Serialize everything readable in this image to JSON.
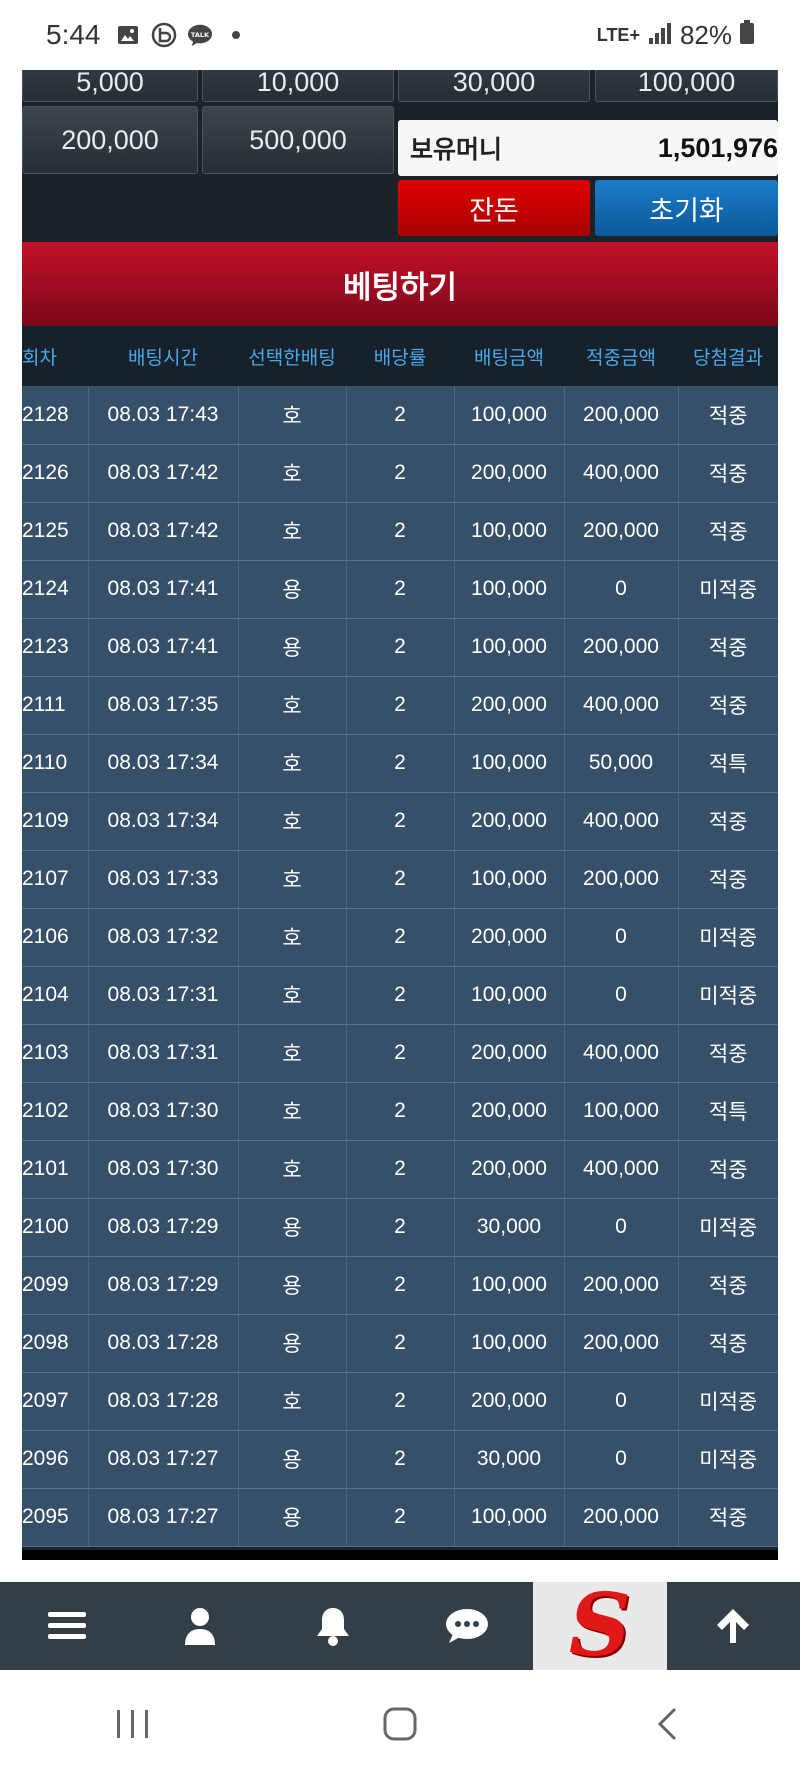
{
  "status": {
    "time": "5:44",
    "network": "LTE+",
    "battery": "82%",
    "icons": [
      "image-icon",
      "b-app-icon",
      "talk-icon",
      "dot-icon"
    ]
  },
  "chips": {
    "row1": [
      "5,000",
      "10,000",
      "30,000",
      "100,000"
    ],
    "row2": [
      "200,000",
      "500,000"
    ]
  },
  "balance": {
    "label": "보유머니",
    "value": "1,501,976"
  },
  "buttons": {
    "all_in": "잔돈",
    "reset": "초기화"
  },
  "bet_title": "베팅하기",
  "table": {
    "headers": [
      "회차",
      "배팅시간",
      "선택한배팅",
      "배당률",
      "배팅금액",
      "적중금액",
      "당첨결과"
    ],
    "rows": [
      {
        "round": "2128",
        "time": "08.03 17:43",
        "pick": "호",
        "odds": "2",
        "bet": "100,000",
        "win": "200,000",
        "result": "적중",
        "type": "win"
      },
      {
        "round": "2126",
        "time": "08.03 17:42",
        "pick": "호",
        "odds": "2",
        "bet": "200,000",
        "win": "400,000",
        "result": "적중",
        "type": "win"
      },
      {
        "round": "2125",
        "time": "08.03 17:42",
        "pick": "호",
        "odds": "2",
        "bet": "100,000",
        "win": "200,000",
        "result": "적중",
        "type": "win"
      },
      {
        "round": "2124",
        "time": "08.03 17:41",
        "pick": "용",
        "odds": "2",
        "bet": "100,000",
        "win": "0",
        "result": "미적중",
        "type": "lose"
      },
      {
        "round": "2123",
        "time": "08.03 17:41",
        "pick": "용",
        "odds": "2",
        "bet": "100,000",
        "win": "200,000",
        "result": "적중",
        "type": "win"
      },
      {
        "round": "2111",
        "time": "08.03 17:35",
        "pick": "호",
        "odds": "2",
        "bet": "200,000",
        "win": "400,000",
        "result": "적중",
        "type": "win"
      },
      {
        "round": "2110",
        "time": "08.03 17:34",
        "pick": "호",
        "odds": "2",
        "bet": "100,000",
        "win": "50,000",
        "result": "적특",
        "type": "special"
      },
      {
        "round": "2109",
        "time": "08.03 17:34",
        "pick": "호",
        "odds": "2",
        "bet": "200,000",
        "win": "400,000",
        "result": "적중",
        "type": "win"
      },
      {
        "round": "2107",
        "time": "08.03 17:33",
        "pick": "호",
        "odds": "2",
        "bet": "100,000",
        "win": "200,000",
        "result": "적중",
        "type": "win"
      },
      {
        "round": "2106",
        "time": "08.03 17:32",
        "pick": "호",
        "odds": "2",
        "bet": "200,000",
        "win": "0",
        "result": "미적중",
        "type": "lose"
      },
      {
        "round": "2104",
        "time": "08.03 17:31",
        "pick": "호",
        "odds": "2",
        "bet": "100,000",
        "win": "0",
        "result": "미적중",
        "type": "lose"
      },
      {
        "round": "2103",
        "time": "08.03 17:31",
        "pick": "호",
        "odds": "2",
        "bet": "200,000",
        "win": "400,000",
        "result": "적중",
        "type": "win"
      },
      {
        "round": "2102",
        "time": "08.03 17:30",
        "pick": "호",
        "odds": "2",
        "bet": "200,000",
        "win": "100,000",
        "result": "적특",
        "type": "special"
      },
      {
        "round": "2101",
        "time": "08.03 17:30",
        "pick": "호",
        "odds": "2",
        "bet": "200,000",
        "win": "400,000",
        "result": "적중",
        "type": "win"
      },
      {
        "round": "2100",
        "time": "08.03 17:29",
        "pick": "용",
        "odds": "2",
        "bet": "30,000",
        "win": "0",
        "result": "미적중",
        "type": "lose"
      },
      {
        "round": "2099",
        "time": "08.03 17:29",
        "pick": "용",
        "odds": "2",
        "bet": "100,000",
        "win": "200,000",
        "result": "적중",
        "type": "win"
      },
      {
        "round": "2098",
        "time": "08.03 17:28",
        "pick": "용",
        "odds": "2",
        "bet": "100,000",
        "win": "200,000",
        "result": "적중",
        "type": "win"
      },
      {
        "round": "2097",
        "time": "08.03 17:28",
        "pick": "호",
        "odds": "2",
        "bet": "200,000",
        "win": "0",
        "result": "미적중",
        "type": "lose"
      },
      {
        "round": "2096",
        "time": "08.03 17:27",
        "pick": "용",
        "odds": "2",
        "bet": "30,000",
        "win": "0",
        "result": "미적중",
        "type": "lose"
      },
      {
        "round": "2095",
        "time": "08.03 17:27",
        "pick": "용",
        "odds": "2",
        "bet": "100,000",
        "win": "200,000",
        "result": "적중",
        "type": "win"
      }
    ]
  },
  "bottom_nav": [
    "menu-icon",
    "user-icon",
    "bell-icon",
    "chat-icon",
    "site-logo",
    "arrow-up-icon"
  ],
  "logo_letter": "S",
  "colors": {
    "win": "#2a7f35",
    "lose": "#d52a2a",
    "special": "#e0a320",
    "header_blue": "#4aa8e6",
    "bet_red": "#c4102a"
  }
}
